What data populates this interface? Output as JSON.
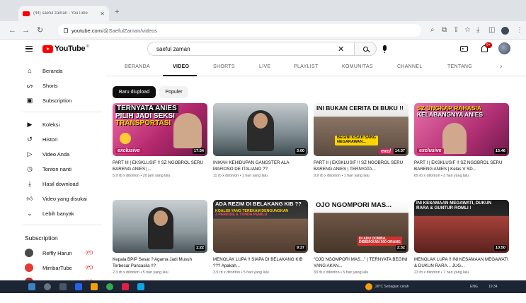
{
  "browser": {
    "tab_title": "(44) saeful zaman - YouTube",
    "url_host": "youtube.com",
    "url_path": "/@SaefulZaman/videos"
  },
  "header": {
    "logo_text": "YouTube",
    "logo_region": "ID",
    "search_value": "saeful zaman",
    "notification_count": "9+"
  },
  "sidebar": {
    "items": [
      {
        "label": "Beranda",
        "icon": "home-icon"
      },
      {
        "label": "Shorts",
        "icon": "shorts-icon"
      },
      {
        "label": "Subscription",
        "icon": "subscriptions-icon"
      },
      {
        "label": "Koleksi",
        "icon": "library-icon"
      },
      {
        "label": "Histori",
        "icon": "history-icon"
      },
      {
        "label": "Video Anda",
        "icon": "your-videos-icon"
      },
      {
        "label": "Tonton nanti",
        "icon": "watch-later-icon"
      },
      {
        "label": "Hasil download",
        "icon": "download-icon"
      },
      {
        "label": "Video yang disukai",
        "icon": "liked-icon"
      },
      {
        "label": "Lebih banyak",
        "icon": "chevron-down-icon"
      }
    ],
    "subscription_title": "Subscription",
    "subscriptions": [
      {
        "name": "Reffly Harun",
        "live": "((•))",
        "color": "#4a4a4a"
      },
      {
        "name": "MimbarTube",
        "live": "((•))",
        "color": "#e53935"
      },
      {
        "name": "tvOneNews",
        "live": "((•))",
        "color": "#c62828"
      }
    ]
  },
  "channel_tabs": {
    "items": [
      "BERANDA",
      "VIDEO",
      "SHORTS",
      "LIVE",
      "PLAYLIST",
      "KOMUNITAS",
      "CHANNEL",
      "TENTANG"
    ],
    "active": "VIDEO"
  },
  "chips": {
    "recent": "Baru diupload",
    "popular": "Populer"
  },
  "videos": [
    {
      "title": "PART III | EKSKLUSIF !! SZ NGOBROL SERU BARENG ANIES |...",
      "meta": "5,9 rb x ditonton • 20 jam yang lalu",
      "duration": "17:54",
      "overlay": [
        "TERNYATA ANIES",
        "PILIH JADI SEKSI",
        "TRANSPORTASI"
      ],
      "tag": "exclusive"
    },
    {
      "title": "INIKAH KEHIDUPAN GANGSTER ALA MAFIOSO DE ITALIANO ??",
      "meta": "11 rb x ditonton • 1 hari yang lalu",
      "duration": "3:00",
      "overlay": [],
      "tag": ""
    },
    {
      "title": "PART II | EKSKLUSIF !! SZ NGOBROL SERU BARENG ANIES | TERNYATA...",
      "meta": "9,9 rb x ditonton • 1 hari yang lalu",
      "duration": "14:37",
      "overlay": [
        "INI BUKAN CERITA DI BUKU !!",
        "BEGINI KISAH SANG",
        "NEGARAWAN..."
      ],
      "tag": "excl"
    },
    {
      "title": "PART I | EKSKLUSIF !! SZ NGOBROL SERU BARENG ANIES | Kelas V SD...",
      "meta": "69 rb x ditonton • 3 hari yang lalu",
      "duration": "15:46",
      "overlay": [
        "SZ UNGKAP RAHASIA",
        "KELABANGNYA ANIES"
      ],
      "tag": "exclusive"
    },
    {
      "title": "Kepala BPIP Sesat ? Agama Jadi Musuh Terbesar Pancasila !!?",
      "meta": "2,3 rb x ditonton • 5 hari yang lalu",
      "duration": "1:22",
      "overlay": [],
      "tag": ""
    },
    {
      "title": "MENOLAK LUPA !! SIAPA DI BELAKANG KIB ??? Apakah...",
      "meta": "3,5 rb x ditonton • 5 hari yang lalu",
      "duration": "9:37",
      "overlay": [
        "ADA REZIM DI BELAKANG KIB ??",
        "KOALISI YANG TEREKAM DENGUNGKAN",
        "3 PERIODE & TUNDA PEMILU"
      ],
      "tag": ""
    },
    {
      "title": "\"OJO NGOMPORI MAS...\" | TERNYATA BEGINI YANG AKAN...",
      "meta": "33 rb x ditonton • 5 hari yang lalu",
      "duration": "2:32",
      "overlay": [
        "OJO NGOMPORI MAS...",
        "DI ADU DOMBA,",
        "DIBISIKKAN 300 ORANG"
      ],
      "tag": ""
    },
    {
      "title": "MENOLAK LUPA !! INI KESAMAAN MEGAWATI & DUKUN RARA... JUG...",
      "meta": "23 rb x ditonton • 7 hari yang lalu",
      "duration": "10:50",
      "overlay": [
        "INI KESAMAAN MEGAWATI, DUKUN",
        "RARA & GUNTUR ROMLI !"
      ],
      "tag": ""
    }
  ],
  "taskbar": {
    "weather": "26°C  Sebagian cerah",
    "lang": "ENG",
    "time": "19:34"
  },
  "colors": {
    "brand_red": "#ff0000",
    "text": "#0f0f0f",
    "muted": "#606060"
  }
}
